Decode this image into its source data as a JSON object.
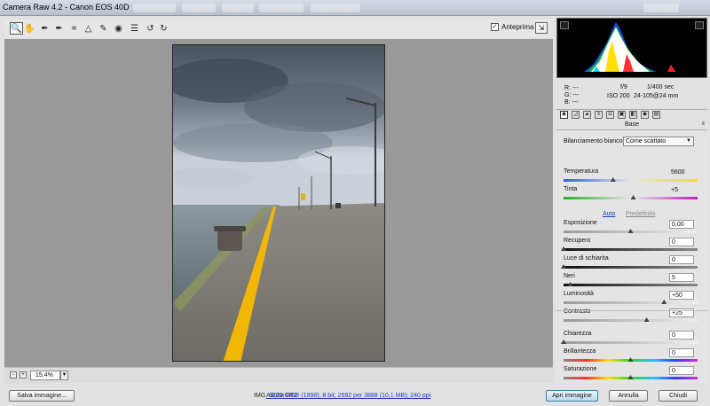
{
  "window": {
    "title": "Camera Raw 4.2  -  Canon EOS 40D"
  },
  "toolbar": {
    "tools": [
      {
        "icon": "zoom-icon",
        "glyph": "🔍"
      },
      {
        "icon": "hand-icon",
        "glyph": "✋"
      },
      {
        "icon": "white-balance-eyedropper-icon",
        "glyph": "✒"
      },
      {
        "icon": "color-sampler-icon",
        "glyph": "✒"
      },
      {
        "icon": "crop-icon",
        "glyph": "⌗"
      },
      {
        "icon": "straighten-icon",
        "glyph": "△"
      },
      {
        "icon": "retouch-icon",
        "glyph": "✎"
      },
      {
        "icon": "red-eye-icon",
        "glyph": "◉"
      },
      {
        "icon": "preferences-icon",
        "glyph": "☰"
      },
      {
        "icon": "rotate-left-icon",
        "glyph": "↺"
      },
      {
        "icon": "rotate-right-icon",
        "glyph": "↻"
      }
    ],
    "preview_label": "Anteprima",
    "preview_checked": true
  },
  "image": {
    "filename": "IMG_0220.CR2"
  },
  "zoom": {
    "value": "15.4%"
  },
  "readout": {
    "r": "R:  ---",
    "g": "G:  ---",
    "b": "B:  ---",
    "aperture": "f/9",
    "shutter": "1/400 sec",
    "iso": "ISO 200",
    "lens": "24-105@24 mm"
  },
  "panel": {
    "title": "Base",
    "white_balance_label": "Bilanciamento bianco:",
    "white_balance_value": "Come scattato",
    "auto_label": "Auto",
    "default_label": "Predefinito",
    "sliders": [
      {
        "key": "temperatura",
        "label": "Temperatura",
        "value": "5600",
        "pos": 0.37,
        "track": "temp",
        "box": false
      },
      {
        "key": "tinta",
        "label": "Tinta",
        "value": "+5",
        "pos": 0.52,
        "track": "tint",
        "box": false
      },
      {
        "key": "esposizione",
        "label": "Esposizione",
        "value": "0,00",
        "pos": 0.5,
        "track": "gray",
        "box": true
      },
      {
        "key": "recupero",
        "label": "Recupero",
        "value": "0",
        "pos": 0.0,
        "track": "dark",
        "box": true
      },
      {
        "key": "luce",
        "label": "Luce di schiarita",
        "value": "0",
        "pos": 0.0,
        "track": "dark",
        "box": true
      },
      {
        "key": "neri",
        "label": "Neri",
        "value": "5",
        "pos": 0.05,
        "track": "dark",
        "box": true
      },
      {
        "key": "luminosita",
        "label": "Luminosità",
        "value": "+50",
        "pos": 0.75,
        "track": "gray",
        "box": true
      },
      {
        "key": "contrasto",
        "label": "Contrasto",
        "value": "+25",
        "pos": 0.62,
        "track": "gray",
        "box": true
      },
      {
        "key": "chiarezza",
        "label": "Chiarezza",
        "value": "0",
        "pos": 0.0,
        "track": "gray",
        "box": true
      },
      {
        "key": "brillantezza",
        "label": "Brillantezza",
        "value": "0",
        "pos": 0.5,
        "track": "rainbow",
        "box": true
      },
      {
        "key": "saturazione",
        "label": "Saturazione",
        "value": "0",
        "pos": 0.5,
        "track": "rainbow",
        "box": true
      }
    ]
  },
  "footer": {
    "save_label": "Salva immagine...",
    "workflow_link": "Adobe RGB (1998); 8 bit; 2592 per 3888 (10,1 MB); 240 ppi",
    "open_label": "Apri immagine",
    "cancel_label": "Annulla",
    "close_label": "Chiudi"
  },
  "colors": {
    "accent_blue": "#3c7fb1",
    "centerline_yellow": "#f2b705"
  }
}
